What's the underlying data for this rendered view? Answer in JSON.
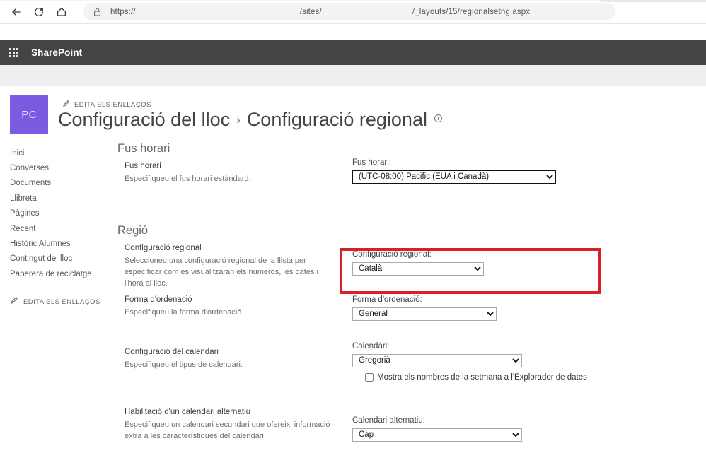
{
  "browser": {
    "back_icon": "back-arrow-icon",
    "reload_icon": "reload-icon",
    "home_icon": "home-icon",
    "site_info_icon": "lock-icon",
    "url_scheme": "https://",
    "url_site": "/sites/",
    "url_path": "/_layouts/15/regionalsetng.aspx"
  },
  "suite": {
    "waffle_icon": "app-launcher-waffle-icon",
    "brand": "SharePoint",
    "bar_color": "#464442"
  },
  "site": {
    "logo_initials": "PC",
    "logo_color": "#7a5ce0",
    "edit_links_top": "EDITA ELS ENLLAÇOS",
    "title_parent": "Configuració del lloc",
    "title_separator": "›",
    "title_current": "Configuració regional",
    "info_icon": "info-circle-icon"
  },
  "left_nav": {
    "items": [
      {
        "label": "Inici"
      },
      {
        "label": "Converses"
      },
      {
        "label": "Documents"
      },
      {
        "label": "Llibreta"
      },
      {
        "label": "Pàgines"
      },
      {
        "label": "Recent"
      },
      {
        "label": "Històric Alumnes"
      },
      {
        "label": "Contingut del lloc"
      },
      {
        "label": "Paperera de reciclatge"
      }
    ],
    "edit_links": "EDITA ELS ENLLAÇOS",
    "pencil_icon": "pencil-edit-icon"
  },
  "sections": {
    "timezone": {
      "heading": "Fus horari",
      "desc_title": "Fus horari",
      "desc_text": "Especifiqueu el fus horari estàndard.",
      "field_label": "Fus horari:",
      "selected": "(UTC-08:00) Pacific (EUA i Canadà)",
      "highlight_color": "#d8202a"
    },
    "region": {
      "heading": "Regió",
      "locale": {
        "desc_title": "Configuració regional",
        "desc_text": "Seleccioneu una configuració regional de la llista per especificar com es visualitzaran els números, les dates i l'hora al lloc.",
        "field_label": "Configuració regional:",
        "selected": "Català"
      },
      "sort_order": {
        "desc_title": "Forma d'ordenació",
        "desc_text": "Especifiqueu la forma d'ordenació.",
        "field_label": "Forma d'ordenació:",
        "selected": "General"
      },
      "calendar": {
        "desc_title": "Configuració del calendari",
        "desc_text": "Especifiqueu el tipus de calendari.",
        "field_label": "Calendari:",
        "selected": "Gregorià",
        "checkbox_label": "Mostra els nombres de la setmana a l'Explorador de dates",
        "checkbox_checked": false
      },
      "alt_calendar": {
        "desc_title": "Habilitació d'un calendari alternatiu",
        "desc_text": "Especifiqueu un calendari secundari que ofereixi informació extra a les característiques del calendari.",
        "field_label": "Calendari alternatiu:",
        "selected": "Cap"
      }
    }
  }
}
